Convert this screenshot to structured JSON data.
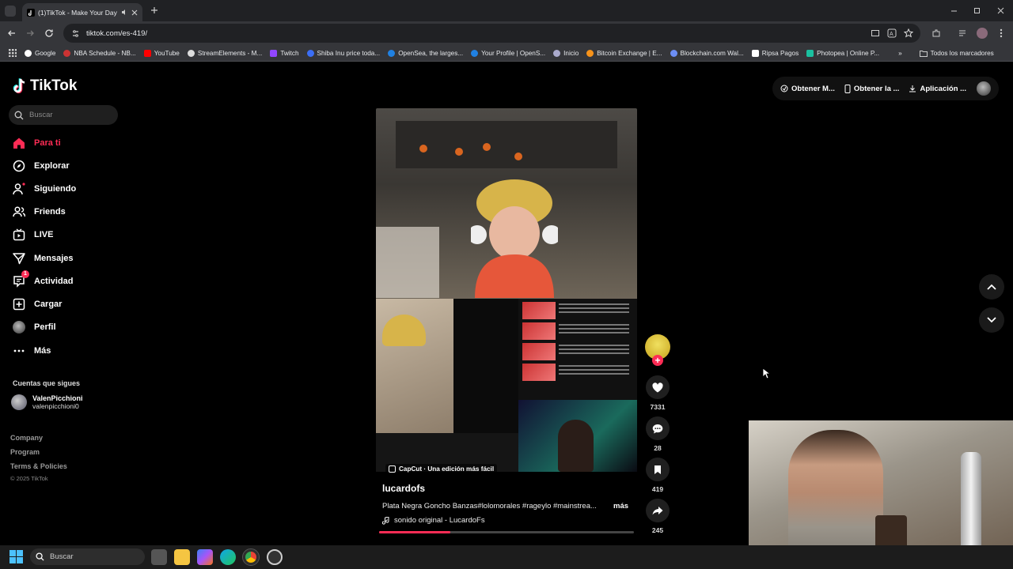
{
  "browser": {
    "tab_title": "(1)TikTok - Make Your Day",
    "url": "tiktok.com/es-419/",
    "bookmarks": [
      "Google",
      "NBA Schedule - NB...",
      "YouTube",
      "StreamElements - M...",
      "Twitch",
      "Shiba Inu price toda...",
      "OpenSea, the larges...",
      "Your Profile | OpenS...",
      "Inicio",
      "Bitcoin Exchange | E...",
      "Blockchain.com Wal...",
      "Ripsa Pagos",
      "Photopea | Online P..."
    ],
    "all_bookmarks": "Todos los marcadores"
  },
  "tiktok": {
    "logo": "TikTok",
    "search_placeholder": "Buscar",
    "nav": [
      {
        "label": "Para ti",
        "icon": "home-icon",
        "active": true
      },
      {
        "label": "Explorar",
        "icon": "compass-icon"
      },
      {
        "label": "Siguiendo",
        "icon": "following-icon"
      },
      {
        "label": "Friends",
        "icon": "friends-icon"
      },
      {
        "label": "LIVE",
        "icon": "live-icon"
      },
      {
        "label": "Mensajes",
        "icon": "messages-icon"
      },
      {
        "label": "Actividad",
        "icon": "activity-icon",
        "badge": "1"
      },
      {
        "label": "Cargar",
        "icon": "upload-icon"
      },
      {
        "label": "Perfil",
        "icon": "profile-avatar"
      },
      {
        "label": "Más",
        "icon": "more-icon"
      }
    ],
    "following_title": "Cuentas que sigues",
    "following": [
      {
        "display": "ValenPicchioni",
        "handle": "valenpicchioni0"
      }
    ],
    "footer": [
      "Company",
      "Program",
      "Terms & Policies"
    ],
    "copyright": "© 2025 TikTok",
    "top_actions": [
      "Obtener M...",
      "Obtener la ...",
      "Aplicación ..."
    ],
    "video": {
      "capcut": "CapCut · Una edición más fácil",
      "author": "lucardofs",
      "description": "Plata Negra Goncho Banzas#lolomorales #rageylo #mainstrea...",
      "more": "más",
      "sound": "sonido original - LucardoFs",
      "progress": 0.28
    },
    "counts": {
      "likes": "7331",
      "comments": "28",
      "saves": "419",
      "shares": "245"
    }
  },
  "taskbar": {
    "search_placeholder": "Buscar"
  },
  "colors": {
    "accent": "#fe2c55",
    "background": "#000000"
  }
}
